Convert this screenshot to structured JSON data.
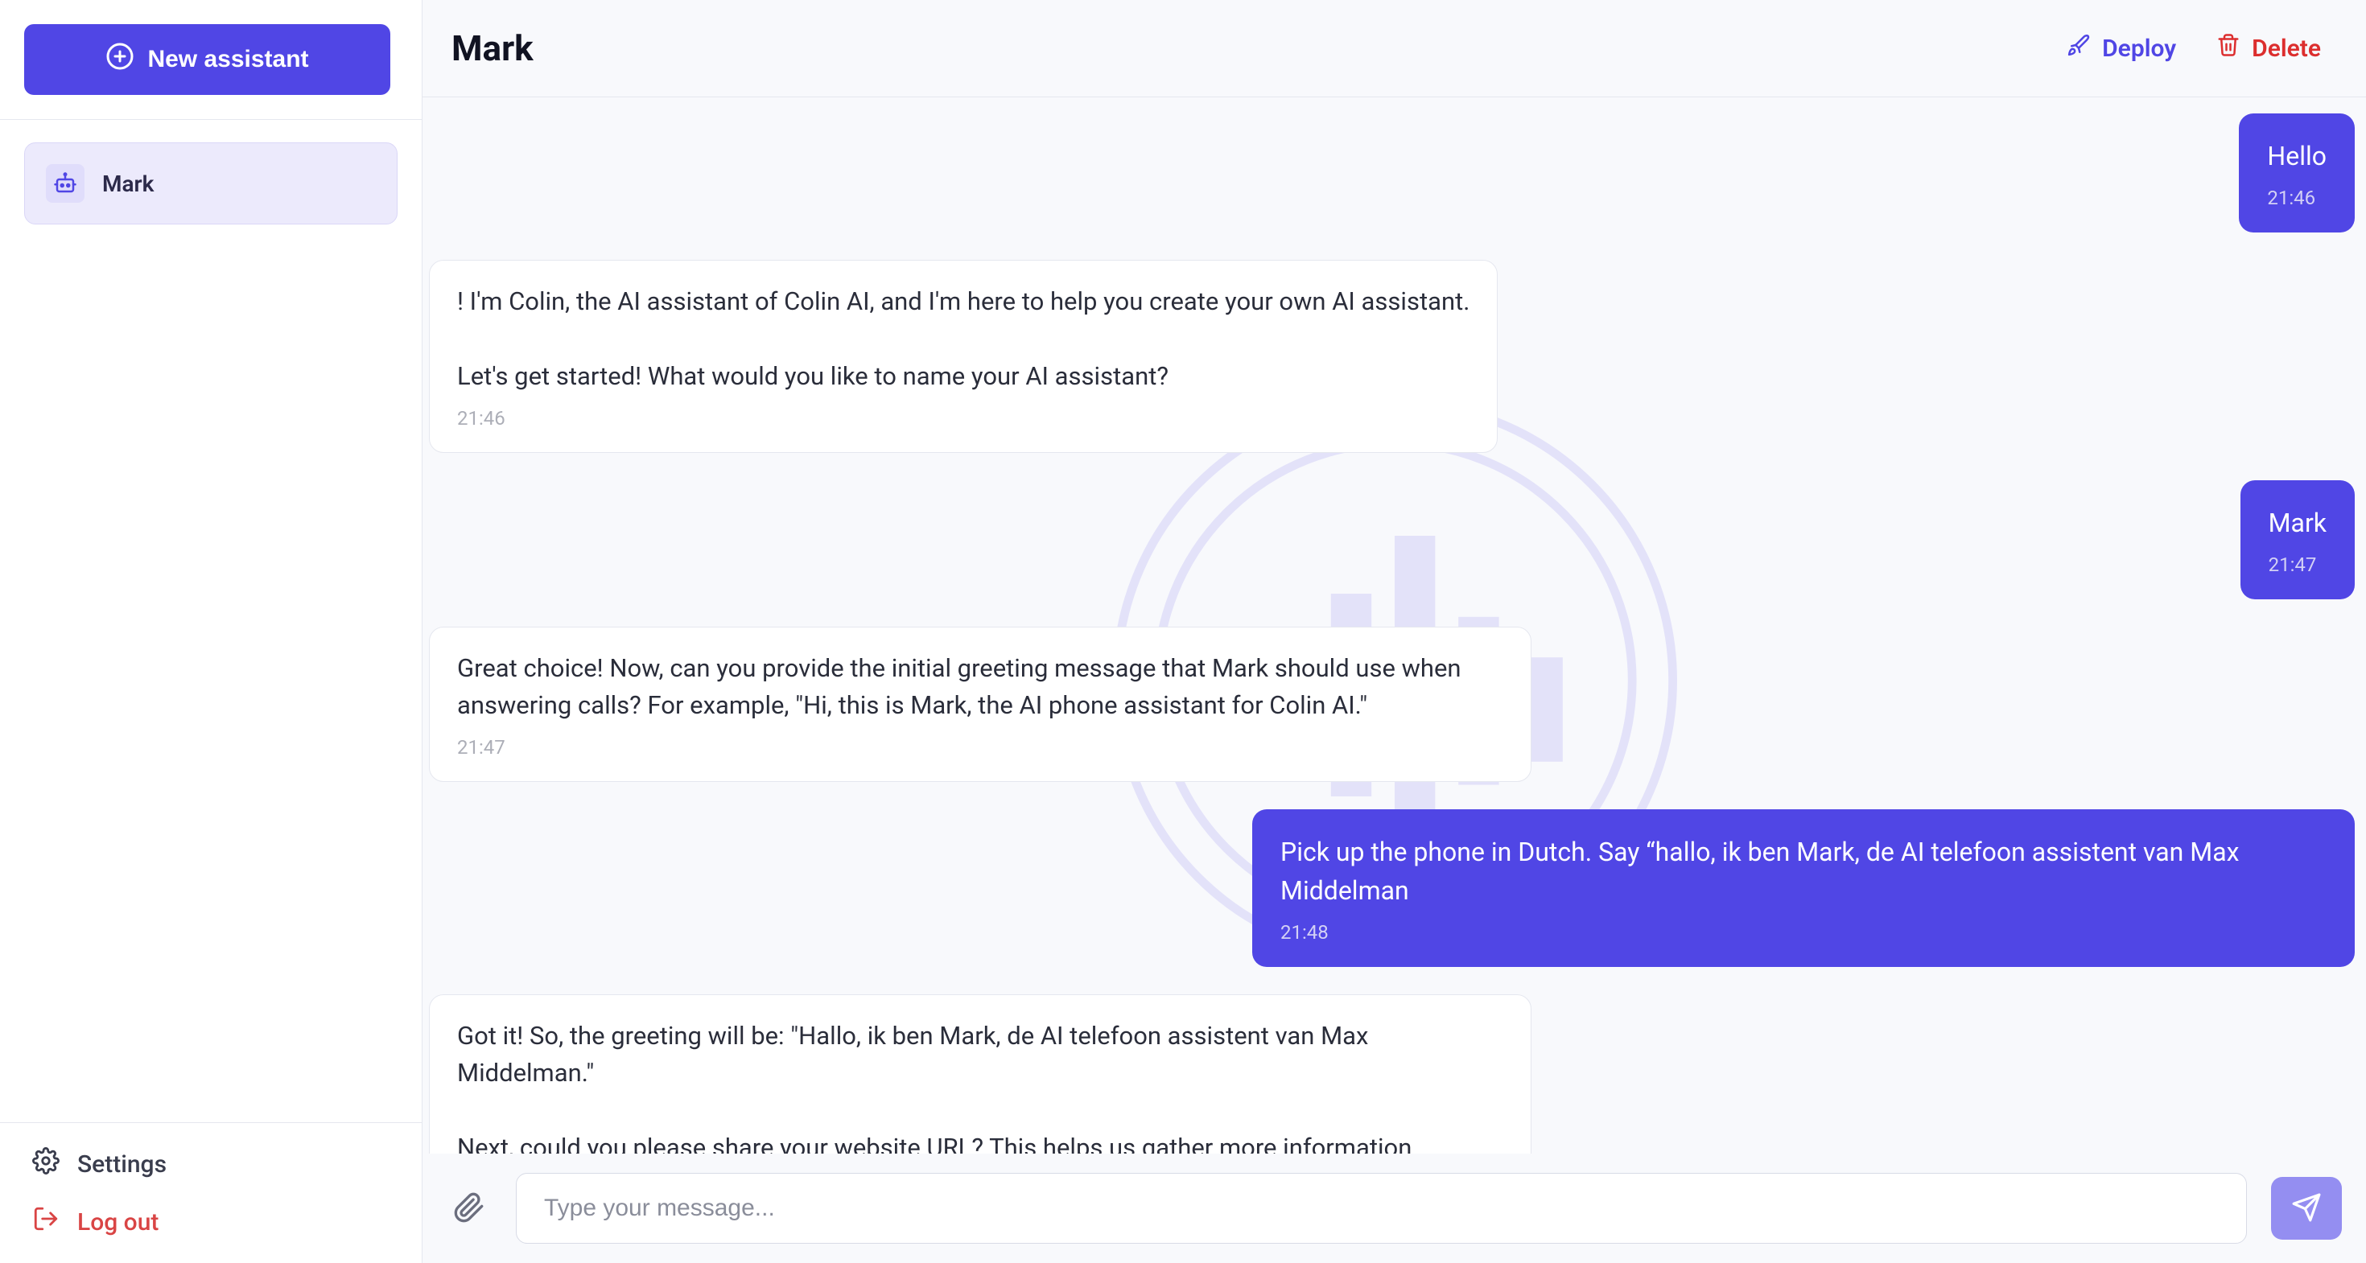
{
  "sidebar": {
    "new_assistant_label": "New assistant",
    "assistants": [
      {
        "name": "Mark"
      }
    ],
    "settings_label": "Settings",
    "logout_label": "Log out"
  },
  "header": {
    "title": "Mark",
    "deploy_label": "Deploy",
    "delete_label": "Delete"
  },
  "composer": {
    "placeholder": "Type your message..."
  },
  "messages": [
    {
      "role": "me",
      "text": "Hello",
      "time": "21:46"
    },
    {
      "role": "them",
      "text": "! I'm Colin, the AI assistant of Colin AI, and I'm here to help you create your own AI assistant.\n\nLet's get started! What would you like to name your AI assistant?",
      "time": "21:46"
    },
    {
      "role": "me",
      "text": "Mark",
      "time": "21:47"
    },
    {
      "role": "them",
      "text": "Great choice! Now, can you provide the initial greeting message that Mark should use when answering calls? For example, \"Hi, this is Mark, the AI phone assistant for Colin AI.\"",
      "time": "21:47"
    },
    {
      "role": "me",
      "text": "Pick up the phone in Dutch. Say “hallo, ik ben Mark, de AI telefoon assistent van Max Middelman",
      "time": "21:48"
    },
    {
      "role": "them",
      "text": "Got it! So, the greeting will be: \"Hallo, ik ben Mark, de AI telefoon assistent van Max Middelman.\"\n\nNext, could you please share your website URL? This helps us gather more information",
      "time": ""
    }
  ],
  "colors": {
    "accent": "#5046e5",
    "danger": "#dc2e2e",
    "bg": "#f8f9fc"
  }
}
